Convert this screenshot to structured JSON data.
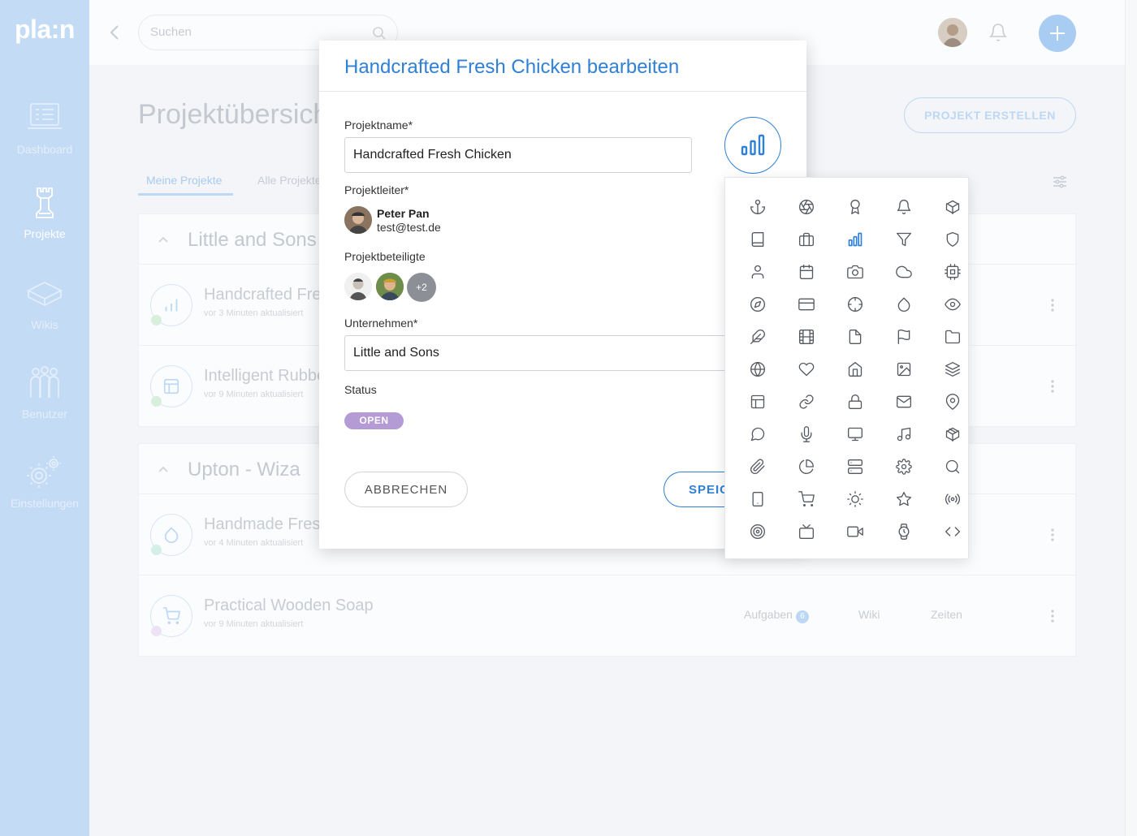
{
  "app": {
    "logo": "pla:n"
  },
  "sidebar": {
    "items": [
      {
        "label": "Dashboard",
        "icon": "dashboard-icon"
      },
      {
        "label": "Projekte",
        "icon": "chess-rook-icon",
        "active": true
      },
      {
        "label": "Wikis",
        "icon": "book-icon"
      },
      {
        "label": "Benutzer",
        "icon": "users-icon"
      },
      {
        "label": "Einstellungen",
        "icon": "gears-icon"
      }
    ]
  },
  "topbar": {
    "search_placeholder": "Suchen"
  },
  "page": {
    "title": "Projektübersicht",
    "create_button": "PROJEKT ERSTELLEN",
    "tabs": [
      {
        "label": "Meine Projekte",
        "active": true
      },
      {
        "label": "Alle Projekte"
      }
    ],
    "groups": [
      {
        "name": "Little and Sons",
        "projects": [
          {
            "name": "Handcrafted Fresh Chicken",
            "meta": "vor 3 Minuten aktualisiert",
            "icon": "bar-chart-icon",
            "dot_color": "#bfe6c6"
          },
          {
            "name": "Intelligent Rubber",
            "meta": "vor 9 Minuten aktualisiert",
            "icon": "layout-icon",
            "dot_color": "#bfe6c6"
          }
        ]
      },
      {
        "name": "Upton - Wiza",
        "projects": [
          {
            "name": "Handmade Fresh",
            "meta": "vor 4 Minuten aktualisiert",
            "icon": "droplet-icon",
            "dot_color": "#bfe8df"
          },
          {
            "name": "Practical Wooden Soap",
            "meta": "vor 9 Minuten aktualisiert",
            "icon": "cart-icon",
            "dot_color": "#e5d9f1",
            "tasks_label": "Aufgaben",
            "tasks_count": "6",
            "wiki_label": "Wiki",
            "times_label": "Zeiten"
          }
        ]
      }
    ]
  },
  "modal": {
    "title": "Handcrafted Fresh Chicken bearbeiten",
    "name_label": "Projektname*",
    "name_value": "Handcrafted Fresh Chicken",
    "leader_label": "Projektleiter*",
    "leader_name": "Peter Pan",
    "leader_email": "test@test.de",
    "participants_label": "Projektbeteiligte",
    "participants_more": "+2",
    "company_label": "Unternehmen*",
    "company_value": "Little and Sons",
    "status_label": "Status",
    "status_value": "OPEN",
    "cancel_label": "ABBRECHEN",
    "save_label": "SPEICHERN",
    "selected_icon": "bar-chart-icon"
  },
  "icon_picker": {
    "selected_index": 7,
    "accent": "#2f80d6",
    "icons": [
      "anchor-icon",
      "aperture-icon",
      "award-icon",
      "bell-icon",
      "box-icon",
      "book-icon",
      "briefcase-icon",
      "bar-chart-icon",
      "filter-icon",
      "shield-icon",
      "user-icon",
      "calendar-icon",
      "camera-icon",
      "cloud-icon",
      "cpu-icon",
      "compass-icon",
      "credit-card-icon",
      "crosshair-icon",
      "droplet-icon",
      "eye-icon",
      "feather-icon",
      "film-icon",
      "file-icon",
      "flag-icon",
      "folder-icon",
      "globe-icon",
      "heart-icon",
      "home-icon",
      "image-icon",
      "layers-icon",
      "layout-icon",
      "link-icon",
      "lock-icon",
      "mail-icon",
      "map-pin-icon",
      "message-circle-icon",
      "mic-icon",
      "monitor-icon",
      "music-icon",
      "package-icon",
      "paperclip-icon",
      "pie-chart-icon",
      "server-icon",
      "settings-icon",
      "search-icon",
      "smartphone-icon",
      "shopping-cart-icon",
      "sun-icon",
      "star-icon",
      "radio-icon",
      "target-icon",
      "tv-icon",
      "video-icon",
      "watch-icon",
      "code-icon"
    ]
  }
}
